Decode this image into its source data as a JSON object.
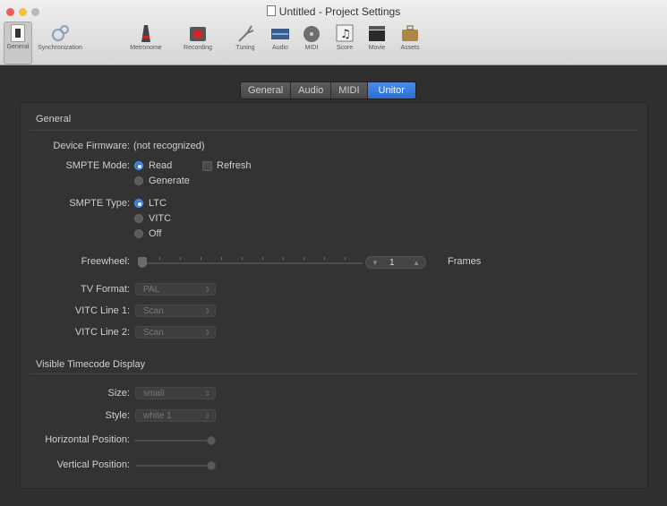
{
  "window": {
    "title": "Untitled - Project Settings"
  },
  "toolbar": {
    "items": [
      {
        "label": "General",
        "icon": "general-icon"
      },
      {
        "label": "Synchronization",
        "icon": "sync-icon"
      },
      {
        "label": "Metronome",
        "icon": "metronome-icon"
      },
      {
        "label": "Recording",
        "icon": "record-icon"
      },
      {
        "label": "Tuning",
        "icon": "tuning-fork-icon"
      },
      {
        "label": "Audio",
        "icon": "audio-icon"
      },
      {
        "label": "MIDI",
        "icon": "midi-icon"
      },
      {
        "label": "Score",
        "icon": "score-icon"
      },
      {
        "label": "Movie",
        "icon": "clapboard-icon"
      },
      {
        "label": "Assets",
        "icon": "briefcase-icon"
      }
    ]
  },
  "tabs": [
    "General",
    "Audio",
    "MIDI",
    "Unitor"
  ],
  "active_tab": "Unitor",
  "general": {
    "header": "General",
    "device_firmware_label": "Device Firmware:",
    "device_firmware_value": "(not recognized)",
    "smpte_mode_label": "SMPTE Mode:",
    "smpte_mode_options": [
      "Read",
      "Generate"
    ],
    "smpte_mode_selected": "Read",
    "refresh_label": "Refresh",
    "smpte_type_label": "SMPTE Type:",
    "smpte_type_options": [
      "LTC",
      "VITC",
      "Off"
    ],
    "smpte_type_selected": "LTC",
    "freewheel_label": "Freewheel:",
    "freewheel_value": "1",
    "freewheel_unit": "Frames",
    "tv_format_label": "TV Format:",
    "tv_format_value": "PAL",
    "vitc_line1_label": "VITC Line 1:",
    "vitc_line1_value": "Scan",
    "vitc_line2_label": "VITC Line 2:",
    "vitc_line2_value": "Scan"
  },
  "timecode": {
    "header": "Visible Timecode Display",
    "size_label": "Size:",
    "size_value": "small",
    "style_label": "Style:",
    "style_value": "white 1",
    "horizontal_label": "Horizontal Position:",
    "vertical_label": "Vertical Position:"
  },
  "colors": {
    "accent": "#2f7be0",
    "panel_bg": "#333333",
    "window_bg": "#2f2f2f"
  }
}
